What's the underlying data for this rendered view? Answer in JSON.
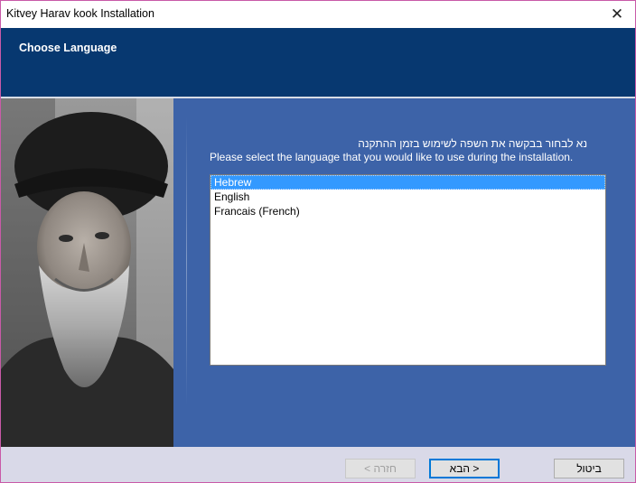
{
  "window": {
    "title": "Kitvey Harav kook Installation",
    "close_glyph": "✕"
  },
  "header": {
    "heading": "Choose Language"
  },
  "content": {
    "prompt_hebrew": "נא לבחור בבקשה את השפה לשימוש בזמן ההתקנה",
    "prompt_english": "Please select the language that you would like to use during the installation.",
    "languages": [
      {
        "label": "Hebrew",
        "selected": true
      },
      {
        "label": "English",
        "selected": false
      },
      {
        "label": "Francais (French)",
        "selected": false
      }
    ]
  },
  "footer": {
    "back_label": "< חזרה",
    "next_label": "הבא >",
    "cancel_label": "ביטול"
  },
  "colors": {
    "header_bg": "#073870",
    "main_bg": "#3d63a8",
    "selection": "#3399ff",
    "footer_bg": "#d9d9e8"
  }
}
